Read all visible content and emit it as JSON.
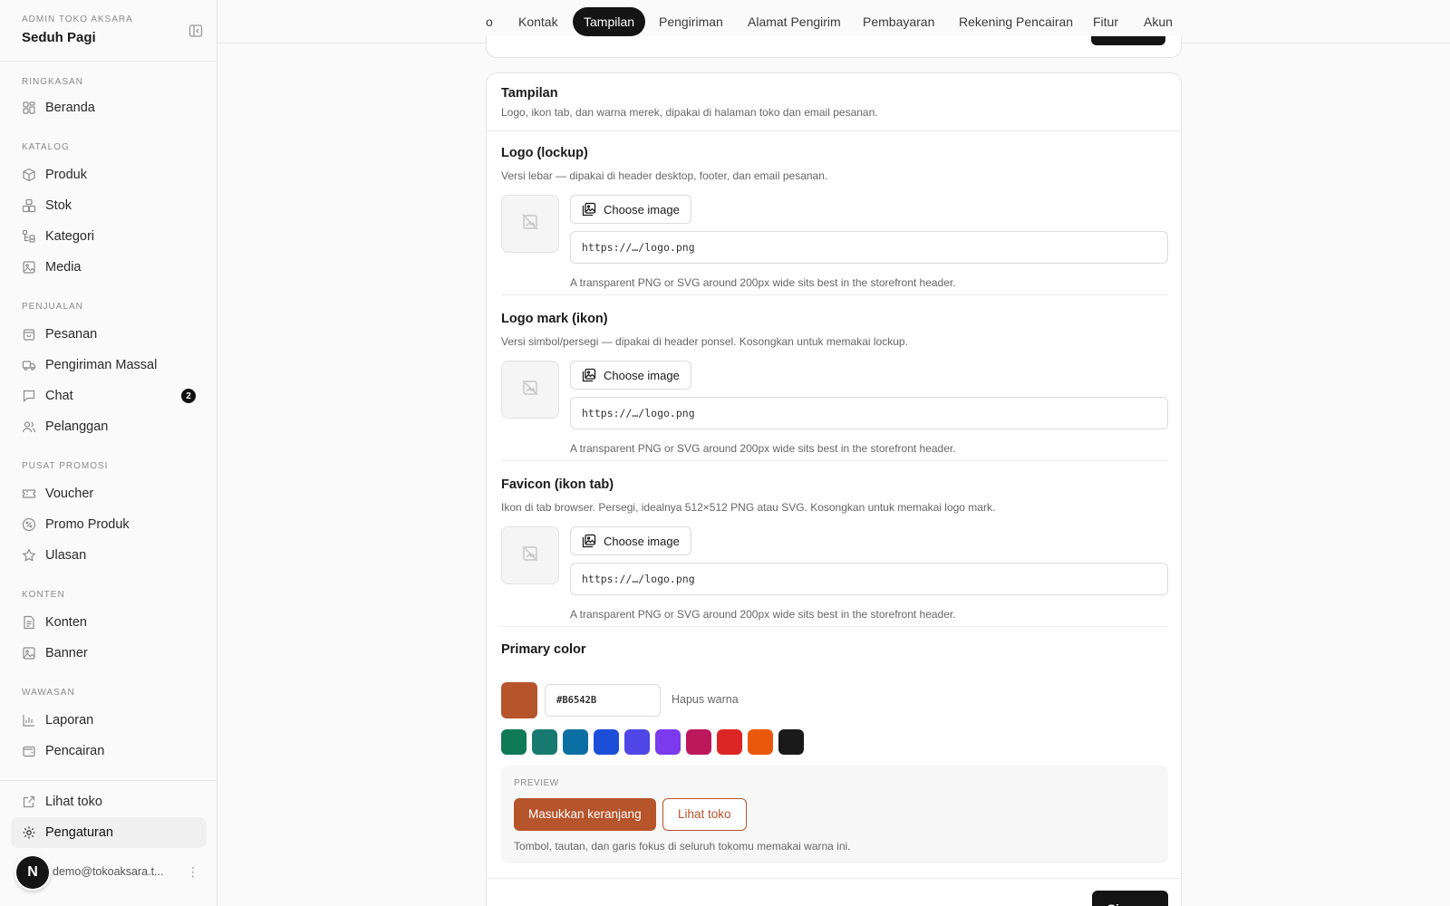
{
  "sidebar": {
    "store_label": "ADMIN TOKO AKSARA",
    "store_name": "Seduh Pagi",
    "sections": [
      {
        "label": "RINGKASAN",
        "items": [
          {
            "label": "Beranda",
            "icon": "dashboard-icon"
          }
        ]
      },
      {
        "label": "KATALOG",
        "items": [
          {
            "label": "Produk",
            "icon": "box-icon"
          },
          {
            "label": "Stok",
            "icon": "boxes-icon"
          },
          {
            "label": "Kategori",
            "icon": "tree-icon"
          },
          {
            "label": "Media",
            "icon": "images-icon"
          }
        ]
      },
      {
        "label": "PENJUALAN",
        "items": [
          {
            "label": "Pesanan",
            "icon": "shopping-bag-icon"
          },
          {
            "label": "Pengiriman Massal",
            "icon": "truck-icon"
          },
          {
            "label": "Chat",
            "icon": "chat-icon",
            "badge": "2"
          },
          {
            "label": "Pelanggan",
            "icon": "users-icon"
          }
        ]
      },
      {
        "label": "PUSAT PROMOSI",
        "items": [
          {
            "label": "Voucher",
            "icon": "ticket-icon"
          },
          {
            "label": "Promo Produk",
            "icon": "percent-icon"
          },
          {
            "label": "Ulasan",
            "icon": "star-icon"
          }
        ]
      },
      {
        "label": "KONTEN",
        "items": [
          {
            "label": "Konten",
            "icon": "document-icon"
          },
          {
            "label": "Banner",
            "icon": "image-icon"
          }
        ]
      },
      {
        "label": "WAWASAN",
        "items": [
          {
            "label": "Laporan",
            "icon": "bar-chart-icon"
          },
          {
            "label": "Pencairan",
            "icon": "wallet-icon"
          }
        ]
      }
    ],
    "bottom_items": [
      {
        "label": "Lihat toko",
        "icon": "external-link-icon"
      },
      {
        "label": "Pengaturan",
        "icon": "gear-icon",
        "active": true
      }
    ],
    "user": {
      "avatar_letter": "N",
      "email": "demo@tokoaksara.t..."
    }
  },
  "tabs": [
    {
      "label": "o"
    },
    {
      "label": "Kontak"
    },
    {
      "label": "Tampilan",
      "active": true
    },
    {
      "label": "Pengiriman"
    },
    {
      "label": "Alamat Pengirim"
    },
    {
      "label": "Pembayaran"
    },
    {
      "label": "Rekening Pencairan"
    },
    {
      "label": "Fitur"
    },
    {
      "label": "Akun"
    }
  ],
  "card": {
    "title": "Tampilan",
    "description": "Logo, ikon tab, dan warna merek, dipakai di halaman toko dan email pesanan."
  },
  "fields": [
    {
      "title": "Logo (lockup)",
      "description": "Versi lebar — dipakai di header desktop, footer, dan email pesanan.",
      "button": "Choose image",
      "value": "https://…/logo.png",
      "help": "A transparent PNG or SVG around 200px wide sits best in the storefront header."
    },
    {
      "title": "Logo mark (ikon)",
      "description": "Versi simbol/persegi — dipakai di header ponsel. Kosongkan untuk memakai lockup.",
      "button": "Choose image",
      "value": "https://…/logo.png",
      "help": "A transparent PNG or SVG around 200px wide sits best in the storefront header."
    },
    {
      "title": "Favicon (ikon tab)",
      "description": "Ikon di tab browser. Persegi, idealnya 512×512 PNG atau SVG. Kosongkan untuk memakai logo mark.",
      "button": "Choose image",
      "value": "https://…/logo.png",
      "help": "A transparent PNG or SVG around 200px wide sits best in the storefront header."
    }
  ],
  "primary_color": {
    "title": "Primary color",
    "value": "#B6542B",
    "clear_label": "Hapus warna",
    "palette": [
      "#0F7A55",
      "#177A6E",
      "#0B6FA4",
      "#1D4ED8",
      "#4F46E5",
      "#7C3AED",
      "#BE185D",
      "#DC2626",
      "#EA580C",
      "#1A1A1A"
    ]
  },
  "preview": {
    "label": "PREVIEW",
    "primary_button": "Masukkan keranjang",
    "outline_button": "Lihat toko",
    "note": "Tombol, tautan, dan garis fokus di seluruh tokomu memakai warna ini."
  },
  "save_label": "Simpan"
}
